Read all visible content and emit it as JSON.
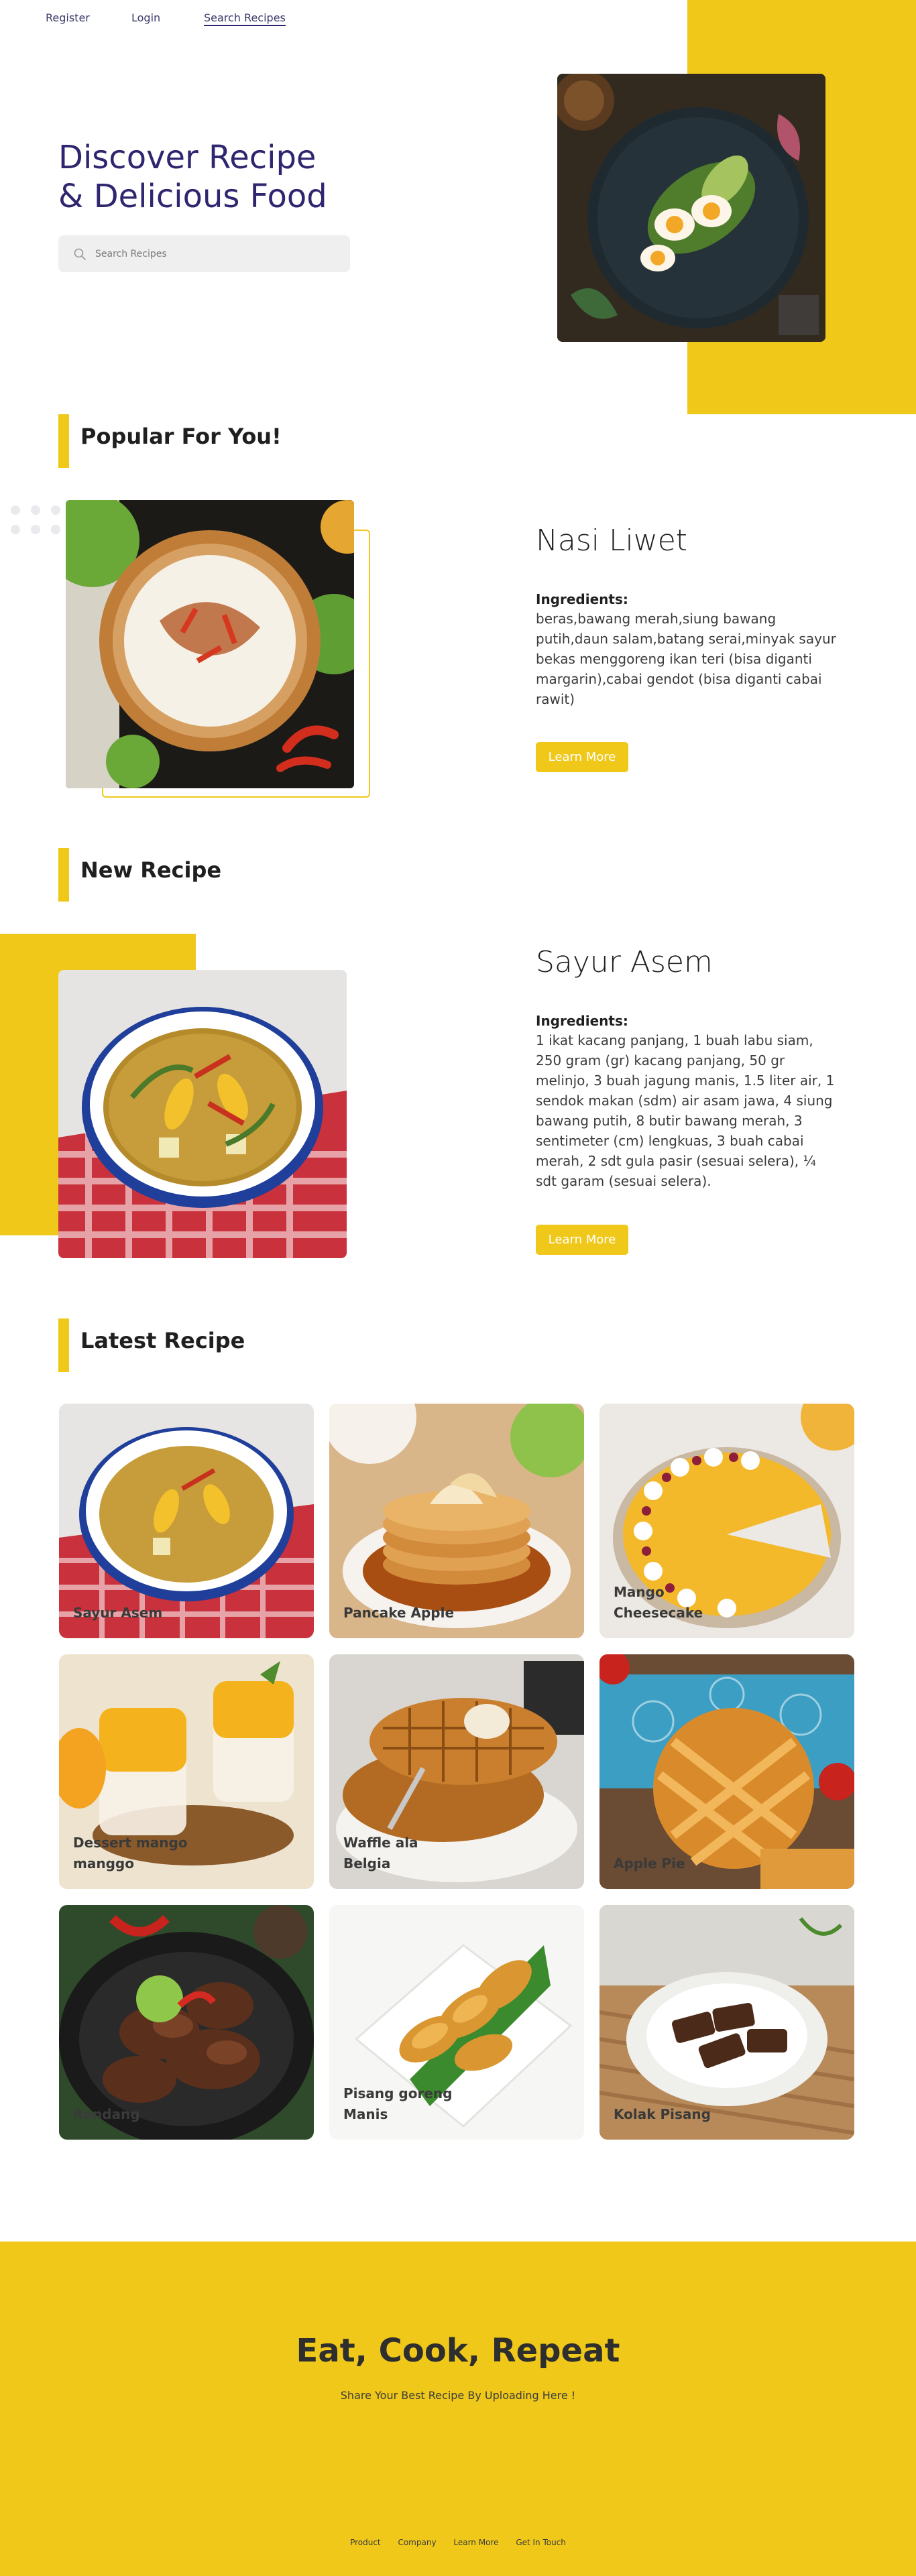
{
  "nav": {
    "register": "Register",
    "login": "Login",
    "search_recipes": "Search Recipes"
  },
  "hero": {
    "title_line1": "Discover Recipe",
    "title_line2": "& Delicious Food",
    "search_placeholder": "Search Recipes",
    "image": "egg-avocado-plate"
  },
  "popular": {
    "heading": "Popular For You!",
    "name": "Nasi Liwet",
    "ingredients_label": "Ingredients:",
    "ingredients": "beras,bawang merah,siung bawang putih,daun salam,batang serai,minyak sayur bekas menggoreng ikan teri (bisa diganti margarin),cabai gendot (bisa diganti cabai rawit)",
    "button": "Learn More",
    "image": "nasi-liwet-bowl"
  },
  "new_recipe": {
    "heading": "New Recipe",
    "name": "Sayur Asem",
    "ingredients_label": "Ingredients:",
    "ingredients": "1 ikat kacang panjang, 1 buah labu siam, 250 gram (gr) kacang panjang, 50 gr melinjo, 3 buah jagung manis, 1.5 liter air, 1 sendok makan (sdm) air asam jawa, 4 siung bawang putih, 8 butir bawang merah, 3 sentimeter (cm) lengkuas, 3 buah cabai merah, 2 sdt gula pasir (sesuai selera), ¼ sdt garam (sesuai selera).",
    "button": "Learn More",
    "image": "sayur-asem-bowl"
  },
  "latest": {
    "heading": "Latest Recipe",
    "cards": [
      {
        "label": "Sayur Asem",
        "image": "sayur-asem"
      },
      {
        "label": "Pancake Apple",
        "image": "pancake"
      },
      {
        "label": "Mango Cheesecake",
        "image": "cheesecake"
      },
      {
        "label": "Dessert mango manggo",
        "image": "mango-dessert"
      },
      {
        "label": "Waffle ala Belgia",
        "image": "waffle"
      },
      {
        "label": "Apple Pie",
        "image": "apple-pie"
      },
      {
        "label": "Rendang",
        "image": "rendang"
      },
      {
        "label": "Pisang goreng Manis",
        "image": "pisang-goreng"
      },
      {
        "label": "Kolak Pisang",
        "image": "kolak"
      }
    ]
  },
  "footer": {
    "title": "Eat, Cook, Repeat",
    "subtitle": "Share Your Best Recipe By Uploading Here !",
    "links": [
      "Product",
      "Company",
      "Learn More",
      "Get In Touch"
    ]
  },
  "colors": {
    "accent": "#efc81a",
    "heading": "#2e266f"
  }
}
